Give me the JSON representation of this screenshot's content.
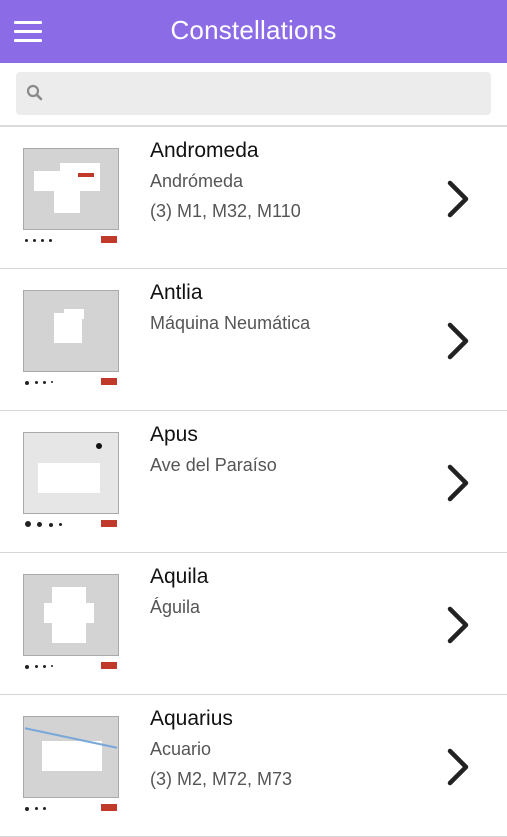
{
  "header": {
    "title": "Constellations",
    "menu_icon": "hamburger-menu-icon"
  },
  "search": {
    "placeholder": "",
    "value": "",
    "icon": "search-icon"
  },
  "constellations": [
    {
      "name": "Andromeda",
      "spanish_name": "Andrómeda",
      "objects": "(3) M1, M32, M110"
    },
    {
      "name": "Antlia",
      "spanish_name": "Máquina Neumática",
      "objects": ""
    },
    {
      "name": "Apus",
      "spanish_name": "Ave del Paraíso",
      "objects": ""
    },
    {
      "name": "Aquila",
      "spanish_name": "Águila",
      "objects": ""
    },
    {
      "name": "Aquarius",
      "spanish_name": "Acuario",
      "objects": "(3) M2, M72, M73"
    }
  ],
  "colors": {
    "accent": "#8c6ce6",
    "chevron": "#222222",
    "thumb_bg": "#d3d3d3"
  }
}
